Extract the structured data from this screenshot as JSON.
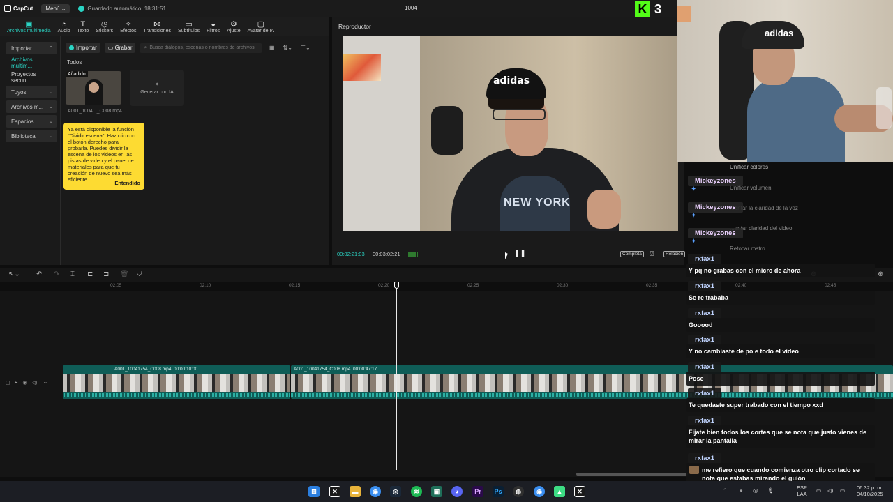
{
  "titlebar": {
    "app_name": "CapCut",
    "menu_label": "Menú",
    "autosave": "Guardado automático: 18:31:51",
    "project_title": "1004",
    "kick_count": "3"
  },
  "toolbar": {
    "tools": [
      {
        "label": "Archivos multimedia",
        "icon": "media-icon"
      },
      {
        "label": "Audio",
        "icon": "audio-icon"
      },
      {
        "label": "Texto",
        "icon": "text-icon"
      },
      {
        "label": "Stickers",
        "icon": "sticker-icon"
      },
      {
        "label": "Efectos",
        "icon": "effects-icon"
      },
      {
        "label": "Transiciones",
        "icon": "transitions-icon"
      },
      {
        "label": "Subtítulos",
        "icon": "subtitles-icon"
      },
      {
        "label": "Filtros",
        "icon": "filters-icon"
      },
      {
        "label": "Ajuste",
        "icon": "adjust-icon"
      },
      {
        "label": "Avatar de IA",
        "icon": "ai-avatar-icon"
      }
    ]
  },
  "sidebar": {
    "items": [
      {
        "label": "Importar"
      },
      {
        "label": "Archivos multim..."
      },
      {
        "label": "Proyectos secun..."
      },
      {
        "label": "Tuyos"
      },
      {
        "label": "Archivos m..."
      },
      {
        "label": "Espacios"
      },
      {
        "label": "Biblioteca"
      }
    ]
  },
  "media": {
    "import_label": "Importar",
    "record_label": "Grabar",
    "search_placeholder": "Busca diálogos, escenas o nombres de archivos",
    "section_label": "Todos",
    "thumb_tag": "Añadido",
    "thumb_name": "A001_1004..._C008.mp4",
    "generate_label": "Generar con IA"
  },
  "tooltip": {
    "text": "Ya está disponible la función \"Dividir escena\". Haz clic con el botón derecho para probarla. Puedes dividir la escena de los videos en las pistas de video y el panel de materiales para que tu creación de nuevo sea más eficiente.",
    "button": "Entendido"
  },
  "player": {
    "title": "Reproductor",
    "current_time": "00:02:21:03",
    "total_time": "00:03:02:21",
    "complete_label": "Completa",
    "ratio_label": "Relación",
    "video_cap_text": "adidas",
    "video_shirt_text": "NEW YORK"
  },
  "webcam": {
    "cap_text": "adidas"
  },
  "ghost_settings": {
    "items": [
      "Unificar colores",
      "Unificar volumen",
      "...entar la claridad de la voz",
      "...entar claridad del video",
      "Retocar rostro"
    ]
  },
  "timeline": {
    "ruler": [
      "02:05",
      "02:10",
      "02:15",
      "02:20",
      "02:25",
      "02:30",
      "02:35",
      "02:40",
      "02:45"
    ],
    "clips": [
      {
        "name": "A001_10041754_C008.mp4",
        "duration": "00:00:10:00"
      },
      {
        "name": "A001_10041754_C008.mp4",
        "duration": "00:00:47:17"
      }
    ]
  },
  "chat": {
    "messages": [
      {
        "user": "Mickeyzones",
        "text": ""
      },
      {
        "user": "Mickeyzones",
        "text": ""
      },
      {
        "user": "Mickeyzones",
        "text": ""
      },
      {
        "user": "rxfax1",
        "text": "Y pq no grabas con el micro de ahora"
      },
      {
        "user": "rxfax1",
        "text": "Se re trababa"
      },
      {
        "user": "rxfax1",
        "text": "Gooood"
      },
      {
        "user": "rxfax1",
        "text": "Y no cambiaste de po e todo el video"
      },
      {
        "user": "rxfax1",
        "text": "Pose"
      },
      {
        "user": "rxfax1",
        "text": "Te quedaste super trabado con el tiempo xxd"
      },
      {
        "user": "rxfax1",
        "text": "Fijate bien todos los cortes que se nota que justo vienes de mirar la pantalla"
      },
      {
        "user": "rxfax1",
        "text": "me refiero que cuando comienza otro clip cortado se nota que estabas mirando el guión"
      }
    ]
  },
  "taskbar": {
    "lang_top": "ESP",
    "lang_bottom": "LAA",
    "time": "06:32 p. m.",
    "date": "04/10/2025",
    "apps": [
      "windows-icon",
      "capcut-icon",
      "explorer-icon",
      "chrome-icon",
      "steam-icon",
      "spotify-icon",
      "code-icon",
      "discord-icon",
      "premiere-icon",
      "photoshop-icon",
      "obs-icon",
      "chrome-alt-icon",
      "android-icon",
      "capcut-active-icon"
    ]
  },
  "colors": {
    "accent": "#2ad3c3",
    "kick_green": "#53fc18",
    "tooltip_yellow": "#fddb32",
    "clip_teal": "#0f5d57"
  }
}
